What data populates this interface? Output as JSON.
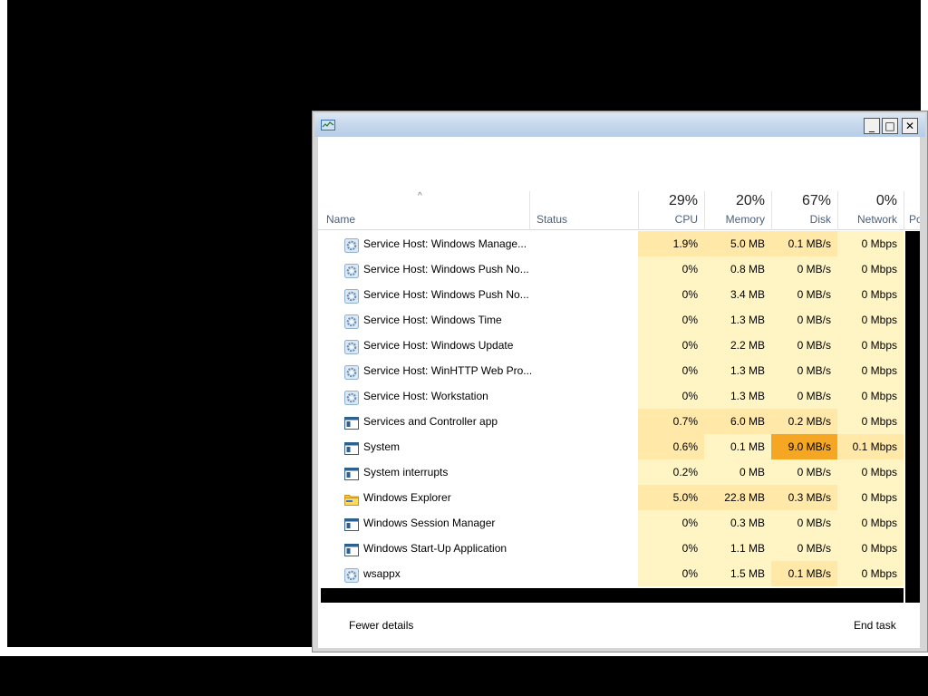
{
  "columns": {
    "name": "Name",
    "status": "Status",
    "cpu": {
      "percent": "29%",
      "label": "CPU"
    },
    "memory": {
      "percent": "20%",
      "label": "Memory"
    },
    "disk": {
      "percent": "67%",
      "label": "Disk"
    },
    "network": {
      "percent": "0%",
      "label": "Network"
    },
    "power_partial": "Po"
  },
  "processes": [
    {
      "name": "Service Host: Windows Manage...",
      "icon": "gear-icon",
      "cpu": "1.9%",
      "memory": "5.0 MB",
      "disk": "0.1 MB/s",
      "network": "0 Mbps"
    },
    {
      "name": "Service Host: Windows Push No...",
      "icon": "gear-icon",
      "cpu": "0%",
      "memory": "0.8 MB",
      "disk": "0 MB/s",
      "network": "0 Mbps"
    },
    {
      "name": "Service Host: Windows Push No...",
      "icon": "gear-icon",
      "cpu": "0%",
      "memory": "3.4 MB",
      "disk": "0 MB/s",
      "network": "0 Mbps"
    },
    {
      "name": "Service Host: Windows Time",
      "icon": "gear-icon",
      "cpu": "0%",
      "memory": "1.3 MB",
      "disk": "0 MB/s",
      "network": "0 Mbps"
    },
    {
      "name": "Service Host: Windows Update",
      "icon": "gear-icon",
      "cpu": "0%",
      "memory": "2.2 MB",
      "disk": "0 MB/s",
      "network": "0 Mbps"
    },
    {
      "name": "Service Host: WinHTTP Web Pro...",
      "icon": "gear-icon",
      "cpu": "0%",
      "memory": "1.3 MB",
      "disk": "0 MB/s",
      "network": "0 Mbps"
    },
    {
      "name": "Service Host: Workstation",
      "icon": "gear-icon",
      "cpu": "0%",
      "memory": "1.3 MB",
      "disk": "0 MB/s",
      "network": "0 Mbps"
    },
    {
      "name": "Services and Controller app",
      "icon": "app-window-icon",
      "cpu": "0.7%",
      "memory": "6.0 MB",
      "disk": "0.2 MB/s",
      "network": "0 Mbps"
    },
    {
      "name": "System",
      "icon": "app-window-icon",
      "cpu": "0.6%",
      "memory": "0.1 MB",
      "disk": "9.0 MB/s",
      "network": "0.1 Mbps"
    },
    {
      "name": "System interrupts",
      "icon": "app-window-icon",
      "cpu": "0.2%",
      "memory": "0 MB",
      "disk": "0 MB/s",
      "network": "0 Mbps"
    },
    {
      "name": "Windows Explorer",
      "icon": "folder-icon",
      "cpu": "5.0%",
      "memory": "22.8 MB",
      "disk": "0.3 MB/s",
      "network": "0 Mbps"
    },
    {
      "name": "Windows Session Manager",
      "icon": "app-window-icon",
      "cpu": "0%",
      "memory": "0.3 MB",
      "disk": "0 MB/s",
      "network": "0 Mbps"
    },
    {
      "name": "Windows Start-Up Application",
      "icon": "app-window-icon",
      "cpu": "0%",
      "memory": "1.1 MB",
      "disk": "0 MB/s",
      "network": "0 Mbps"
    },
    {
      "name": "wsappx",
      "icon": "gear-icon",
      "cpu": "0%",
      "memory": "1.5 MB",
      "disk": "0.1 MB/s",
      "network": "0 Mbps"
    }
  ],
  "footer": {
    "fewer_details": "Fewer details",
    "end_task": "End task"
  },
  "titlebar": {
    "minimize": "_",
    "maximize": "□",
    "close": "✕"
  },
  "colors": {
    "heat_low": "#fff4c4",
    "heat_mid": "#ffe8a8",
    "heat_high": "#f9c050",
    "heat_max": "#f5a623"
  }
}
